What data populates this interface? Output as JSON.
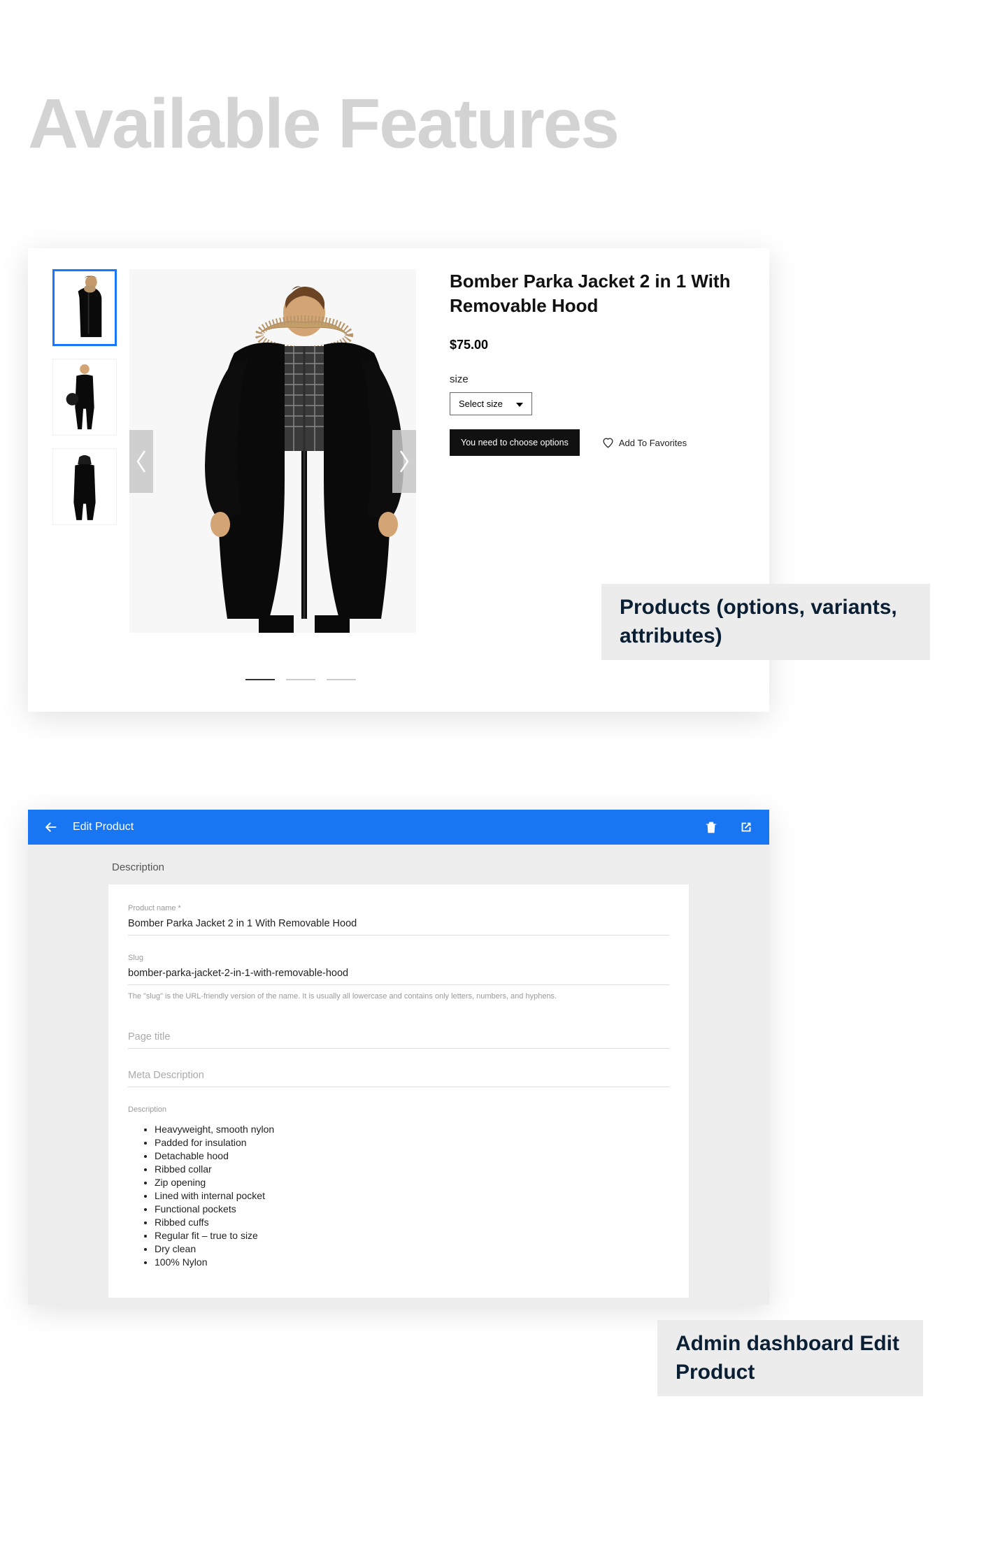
{
  "page_heading": "Available Features",
  "product": {
    "title": "Bomber Parka Jacket 2 in 1 With Removable Hood",
    "price": "$75.00",
    "option_label": "size",
    "select_placeholder": "Select size",
    "add_button": "You need to choose options",
    "favorite_label": "Add To Favorites"
  },
  "caption1": "Products (options, variants, attributes)",
  "admin": {
    "bar_title": "Edit Product",
    "section_label": "Description",
    "fields": {
      "product_name_label": "Product name *",
      "product_name_value": "Bomber Parka Jacket 2 in 1 With Removable Hood",
      "slug_label": "Slug",
      "slug_value": "bomber-parka-jacket-2-in-1-with-removable-hood",
      "slug_hint": "The \"slug\" is the URL-friendly version of the name. It is usually all lowercase and contains only letters, numbers, and hyphens.",
      "page_title_placeholder": "Page title",
      "meta_desc_placeholder": "Meta Description",
      "desc_label": "Description"
    },
    "description_bullets": [
      "Heavyweight, smooth nylon",
      "Padded for insulation",
      "Detachable hood",
      "Ribbed collar",
      "Zip opening",
      "Lined with internal pocket",
      "Functional pockets",
      "Ribbed cuffs",
      "Regular fit – true to size",
      "Dry clean",
      "100% Nylon"
    ]
  },
  "caption2": "Admin dashboard Edit Product"
}
